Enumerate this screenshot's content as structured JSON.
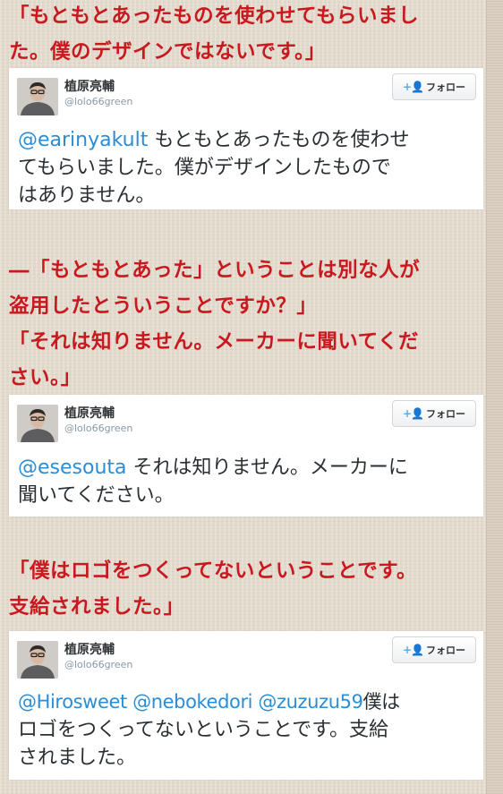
{
  "quotes": [
    {
      "lines": [
        "「もともとあったものを使わせてもらいまし",
        "た。僕のデザインではないです。」"
      ]
    },
    {
      "lines": [
        "―「もともとあった」ということは別な人が",
        "盗用したとういうことですか？」",
        "「それは知りません。メーカーに聞いてくだ",
        "さい。」"
      ]
    },
    {
      "lines": [
        "「僕はロゴをつくってないということです。",
        "支給されました。」"
      ]
    }
  ],
  "tweets": [
    {
      "name": "植原亮輔",
      "handle": "@lolo66green",
      "follow_label": "フォロー",
      "follow_icon": "+👤",
      "mentions": [
        "@earinyakult"
      ],
      "lines": [
        "もともとあったものを使わせ",
        "てもらいました。僕がデザインしたもので",
        "はありません。"
      ]
    },
    {
      "name": "植原亮輔",
      "handle": "@lolo66green",
      "follow_label": "フォロー",
      "follow_icon": "+👤",
      "mentions": [
        "@esesouta"
      ],
      "lines": [
        "それは知りません。メーカーに",
        "聞いてください。"
      ]
    },
    {
      "name": "植原亮輔",
      "handle": "@lolo66green",
      "follow_label": "フォロー",
      "follow_icon": "+👤",
      "mentions": [
        "@Hirosweet",
        "@nebokedori",
        "@zuzuzu59"
      ],
      "lines": [
        "僕は",
        "ロゴをつくってないということです。支給",
        "されました。"
      ]
    }
  ],
  "colors": {
    "quote_red": "#c8191e",
    "mention_blue": "#2a8dd6",
    "follow_icon_blue": "#55acee"
  }
}
